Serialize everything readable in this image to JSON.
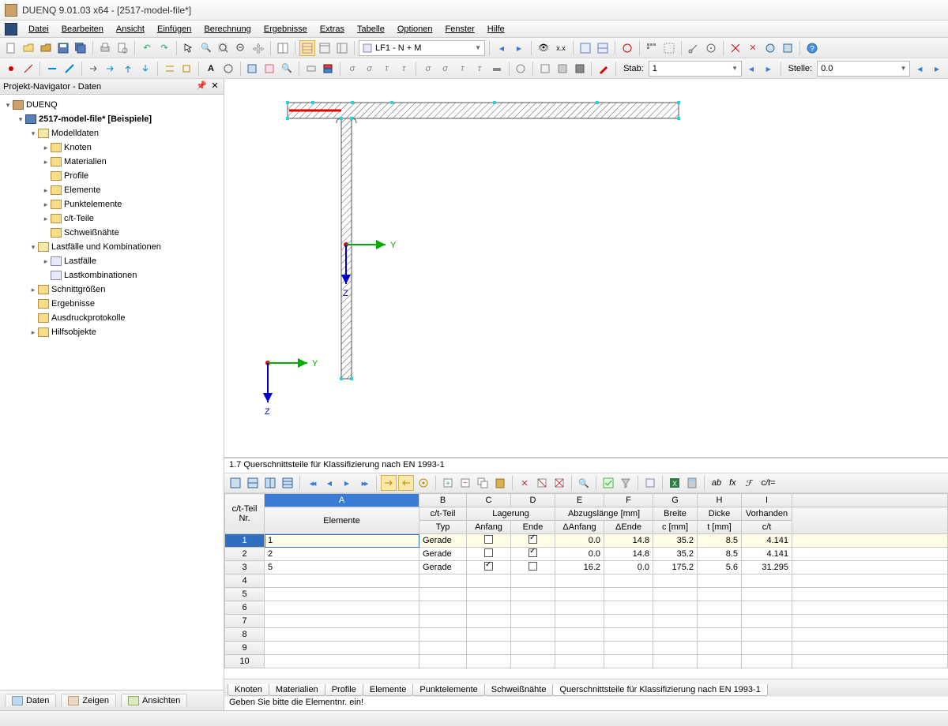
{
  "window": {
    "title": "DUENQ 9.01.03 x64 - [2517-model-file*]"
  },
  "menu": [
    "Datei",
    "Bearbeiten",
    "Ansicht",
    "Einfügen",
    "Berechnung",
    "Ergebnisse",
    "Extras",
    "Tabelle",
    "Optionen",
    "Fenster",
    "Hilfe"
  ],
  "toolbar1": {
    "lf_combo": "LF1 - N + M",
    "stab_label": "Stab:",
    "stab_value": "1",
    "stelle_label": "Stelle:",
    "stelle_value": "0.0"
  },
  "navigator": {
    "title": "Projekt-Navigator - Daten",
    "root": "DUENQ",
    "file": "2517-model-file* [Beispiele]",
    "modelldaten": {
      "label": "Modelldaten",
      "children": [
        "Knoten",
        "Materialien",
        "Profile",
        "Elemente",
        "Punktelemente",
        "c/t-Teile",
        "Schweißnähte"
      ]
    },
    "lastfaelle_group": {
      "label": "Lastfälle und Kombinationen",
      "children": [
        "Lastfälle",
        "Lastkombinationen"
      ]
    },
    "others": [
      "Schnittgrößen",
      "Ergebnisse",
      "Ausdruckprotokolle",
      "Hilfsobjekte"
    ],
    "bottom_tabs": [
      "Daten",
      "Zeigen",
      "Ansichten"
    ]
  },
  "viewport": {
    "axis_y": "Y",
    "axis_z": "Z"
  },
  "table": {
    "title": "1.7 Querschnittsteile für Klassifizierung nach EN 1993-1",
    "ct_label": "c/t=",
    "fx_label": "fx",
    "col_letters": [
      "A",
      "B",
      "C",
      "D",
      "E",
      "F",
      "G",
      "H",
      "I"
    ],
    "head1": {
      "ct_nr": "c/t-Teil",
      "ct_teil": "c/t-Teil",
      "lagerung": "Lagerung",
      "abzug": "Abzugslänge [mm]",
      "breite": "Breite",
      "dicke": "Dicke",
      "vorh": "Vorhanden"
    },
    "head2": {
      "nr": "Nr.",
      "elemente": "Elemente",
      "typ": "Typ",
      "anfang": "Anfang",
      "ende": "Ende",
      "danf": "ΔAnfang",
      "dende": "ΔEnde",
      "c": "c [mm]",
      "t": "t [mm]",
      "ct": "c/t"
    },
    "rows": [
      {
        "nr": "1",
        "el": "1",
        "typ": "Gerade",
        "anf": false,
        "end": true,
        "danf": "0.0",
        "dende": "14.8",
        "c": "35.2",
        "t": "8.5",
        "ct": "4.141"
      },
      {
        "nr": "2",
        "el": "2",
        "typ": "Gerade",
        "anf": false,
        "end": true,
        "danf": "0.0",
        "dende": "14.8",
        "c": "35.2",
        "t": "8.5",
        "ct": "4.141"
      },
      {
        "nr": "3",
        "el": "5",
        "typ": "Gerade",
        "anf": true,
        "end": false,
        "danf": "16.2",
        "dende": "0.0",
        "c": "175.2",
        "t": "5.6",
        "ct": "31.295"
      }
    ],
    "empty_rows": [
      "4",
      "5",
      "6",
      "7",
      "8",
      "9",
      "10"
    ],
    "tabs": [
      "Knoten",
      "Materialien",
      "Profile",
      "Elemente",
      "Punktelemente",
      "Schweißnähte",
      "Querschnittsteile für Klassifizierung nach EN 1993-1"
    ],
    "status": "Geben Sie bitte die Elementnr. ein!"
  }
}
